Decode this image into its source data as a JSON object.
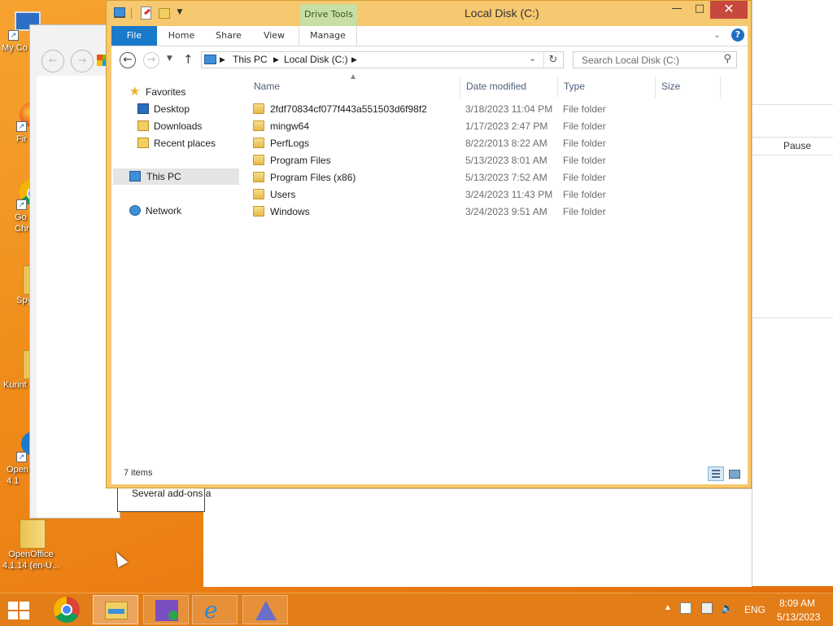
{
  "desktop": {
    "icons": [
      {
        "label": "My Co"
      },
      {
        "label": "Fir"
      },
      {
        "label": "Go\nChr"
      },
      {
        "label": "Spy"
      },
      {
        "label": "Kurint"
      },
      {
        "label": "Open\n4.1"
      },
      {
        "label": "OpenOffice\n4.1.14 (en-U..."
      }
    ]
  },
  "background": {
    "addons_text": "Several add-ons a",
    "pause_label": "Pause"
  },
  "explorer": {
    "title": "Local Disk (C:)",
    "drive_tools": "Drive Tools",
    "window_controls": {
      "minimize": "—",
      "maximize": "□",
      "close": "✕"
    },
    "ribbon_tabs": [
      "File",
      "Home",
      "Share",
      "View",
      "Manage"
    ],
    "help": "?",
    "address": {
      "crumbs": [
        "This PC",
        "Local Disk (C:)"
      ]
    },
    "search": {
      "placeholder": "Search Local Disk (C:)"
    },
    "nav": {
      "favorites": "Favorites",
      "desktop": "Desktop",
      "downloads": "Downloads",
      "recent": "Recent places",
      "thispc": "This PC",
      "network": "Network"
    },
    "columns": {
      "name": "Name",
      "date": "Date modified",
      "type": "Type",
      "size": "Size"
    },
    "files": [
      {
        "name": "2fdf70834cf077f443a551503d6f98f2",
        "date": "3/18/2023 11:04 PM",
        "type": "File folder"
      },
      {
        "name": "mingw64",
        "date": "1/17/2023 2:47 PM",
        "type": "File folder"
      },
      {
        "name": "PerfLogs",
        "date": "8/22/2013 8:22 AM",
        "type": "File folder"
      },
      {
        "name": "Program Files",
        "date": "5/13/2023 8:01 AM",
        "type": "File folder"
      },
      {
        "name": "Program Files (x86)",
        "date": "5/13/2023 7:52 AM",
        "type": "File folder"
      },
      {
        "name": "Users",
        "date": "3/24/2023 11:43 PM",
        "type": "File folder"
      },
      {
        "name": "Windows",
        "date": "3/24/2023 9:51 AM",
        "type": "File folder"
      }
    ],
    "status": "7 items"
  },
  "taskbar": {
    "language": "ENG",
    "time": "8:09 AM",
    "date": "5/13/2023"
  },
  "colors": {
    "desktop": "#f08d1a",
    "window_frame": "#f6c86f",
    "file_tab": "#1979ca",
    "drive_tools": "#c7dfa4",
    "close": "#c7483c"
  }
}
